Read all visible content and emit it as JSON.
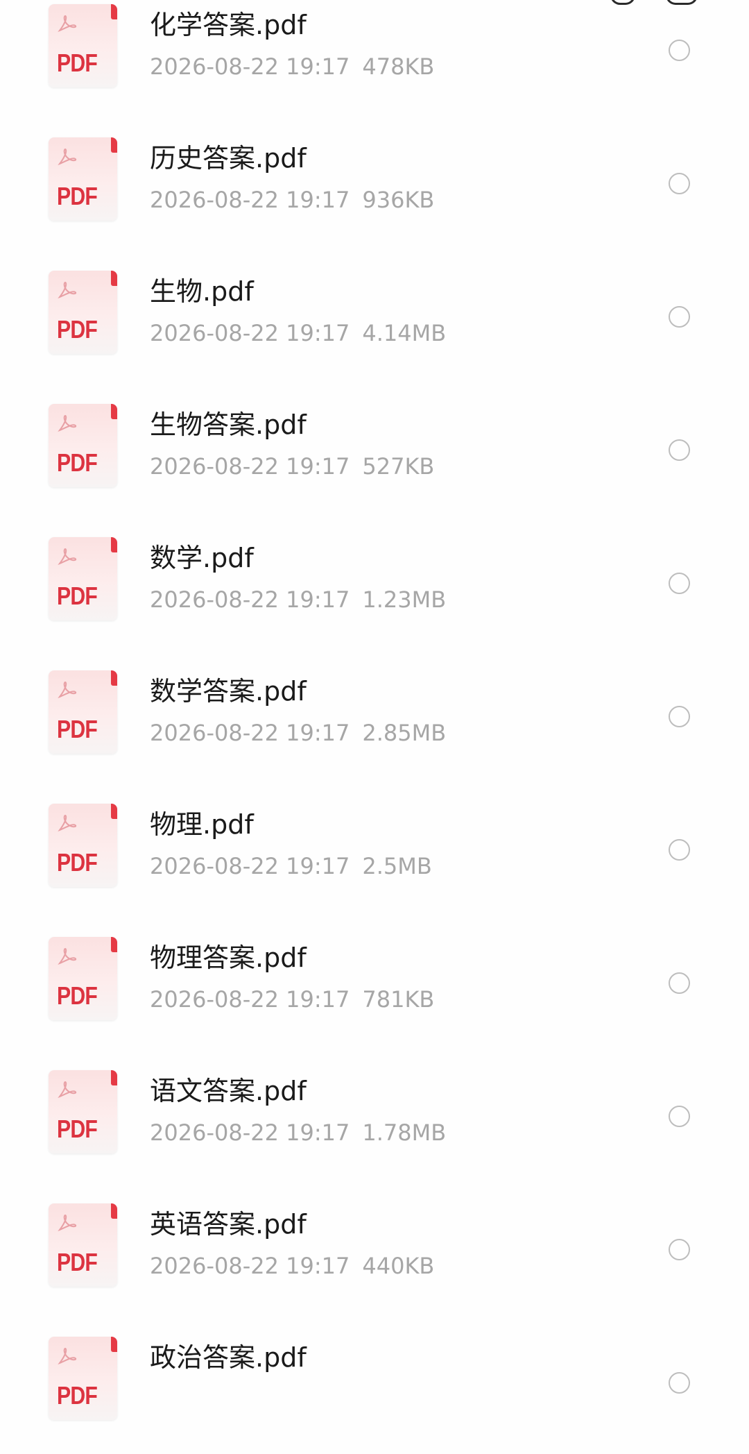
{
  "files": [
    {
      "name": "化学答案.pdf",
      "date": "2026-08-22 19:17",
      "size": "478KB",
      "icon": "pdf-file-icon",
      "icon_text": "PDF"
    },
    {
      "name": "历史答案.pdf",
      "date": "2026-08-22 19:17",
      "size": "936KB",
      "icon": "pdf-file-icon",
      "icon_text": "PDF"
    },
    {
      "name": "生物.pdf",
      "date": "2026-08-22 19:17",
      "size": "4.14MB",
      "icon": "pdf-file-icon",
      "icon_text": "PDF"
    },
    {
      "name": "生物答案.pdf",
      "date": "2026-08-22 19:17",
      "size": "527KB",
      "icon": "pdf-file-icon",
      "icon_text": "PDF"
    },
    {
      "name": "数学.pdf",
      "date": "2026-08-22 19:17",
      "size": "1.23MB",
      "icon": "pdf-file-icon",
      "icon_text": "PDF"
    },
    {
      "name": "数学答案.pdf",
      "date": "2026-08-22 19:17",
      "size": "2.85MB",
      "icon": "pdf-file-icon",
      "icon_text": "PDF"
    },
    {
      "name": "物理.pdf",
      "date": "2026-08-22 19:17",
      "size": "2.5MB",
      "icon": "pdf-file-icon",
      "icon_text": "PDF"
    },
    {
      "name": "物理答案.pdf",
      "date": "2026-08-22 19:17",
      "size": "781KB",
      "icon": "pdf-file-icon",
      "icon_text": "PDF"
    },
    {
      "name": "语文答案.pdf",
      "date": "2026-08-22 19:17",
      "size": "1.78MB",
      "icon": "pdf-file-icon",
      "icon_text": "PDF"
    },
    {
      "name": "英语答案.pdf",
      "date": "2026-08-22 19:17",
      "size": "440KB",
      "icon": "pdf-file-icon",
      "icon_text": "PDF"
    },
    {
      "name": "政治答案.pdf",
      "date": "",
      "size": "",
      "icon": "pdf-file-icon",
      "icon_text": "PDF"
    }
  ],
  "colors": {
    "pdf_red": "#dc3340",
    "name_text": "#1a1a1a",
    "meta_text": "#a6a6a6",
    "radio_border": "#bdbdbd"
  }
}
